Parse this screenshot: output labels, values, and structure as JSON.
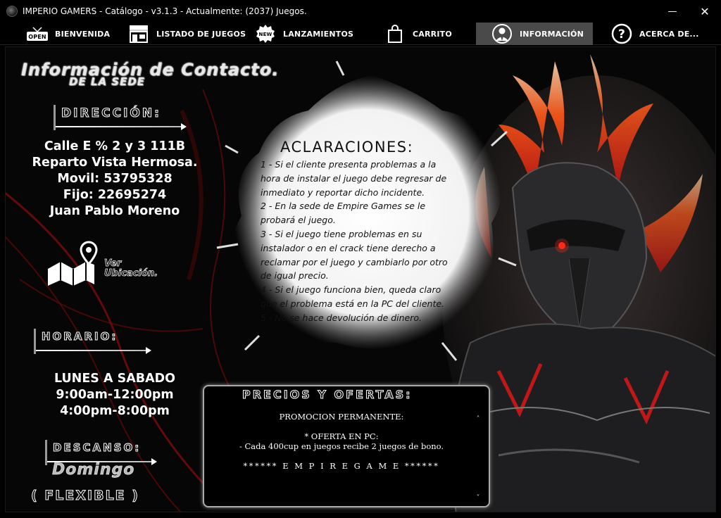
{
  "window": {
    "title": "IMPERIO GAMERS - Catálogo - v3.1.3 - Actualmente: (2037) Juegos.",
    "minimize_glyph": "—",
    "close_glyph": "✕"
  },
  "tabs": [
    {
      "label": "BIENVENIDA",
      "icon": "open-sign-icon"
    },
    {
      "label": "LISTADO DE JUEGOS",
      "icon": "store-icon"
    },
    {
      "label": "LANZAMIENTOS",
      "icon": "new-badge-icon"
    },
    {
      "label": "CARRITO",
      "icon": "shopping-bag-icon"
    },
    {
      "label": "INFORMACIÓN",
      "icon": "user-suit-icon",
      "active": true
    },
    {
      "label": "ACERCA DE...",
      "icon": "question-circle-icon"
    }
  ],
  "contact": {
    "title": "Información de Contacto.",
    "subtitle": "DE LA SEDE",
    "address_label": "DIRECCIÓN:",
    "address_lines": [
      "Calle E % 2 y 3 111B",
      "Reparto Vista Hermosa.",
      "Movil: 53795328",
      "Fijo: 22695274",
      "Juan Pablo Moreno"
    ],
    "map_link_line1": "Ver",
    "map_link_line2": "Ubicación.",
    "schedule_label": "HORARIO:",
    "schedule_lines": [
      "LUNES A SABADO",
      "9:00am-12:00pm",
      "4:00pm-8:00pm"
    ],
    "rest_label": "DESCANSO:",
    "rest_day": "Domingo",
    "rest_note": "( FLEXIBLE )"
  },
  "aclaraciones": {
    "title": "ACLARACIONES:",
    "lines": [
      "1 -  Si el cliente presenta problemas a la",
      "hora de instalar el juego debe regresar de",
      "inmediato y reportar dicho incidente.",
      "2 - En la sede de Empire Games se le",
      "probará el juego.",
      "3 - Si el juego tiene problemas en su",
      "instalador o en el crack tiene derecho a",
      "reclamar por el juego y cambiarlo por otro",
      "de igual precio.",
      "4 - Si el juego funciona bien, queda claro",
      "que el problema está en la PC del cliente.",
      "5 - No se hace devolución de dinero."
    ]
  },
  "precios": {
    "title": "PRECIOS Y OFERTAS:",
    "promo_heading": "PROMOCION PERMANENTE:",
    "offer_heading": "* OFERTA EN PC:",
    "offer_detail": "- Cada 400cup en juegos recibe 2 juegos de bono.",
    "footer": "****** E M P I R E   G A M E ******"
  }
}
